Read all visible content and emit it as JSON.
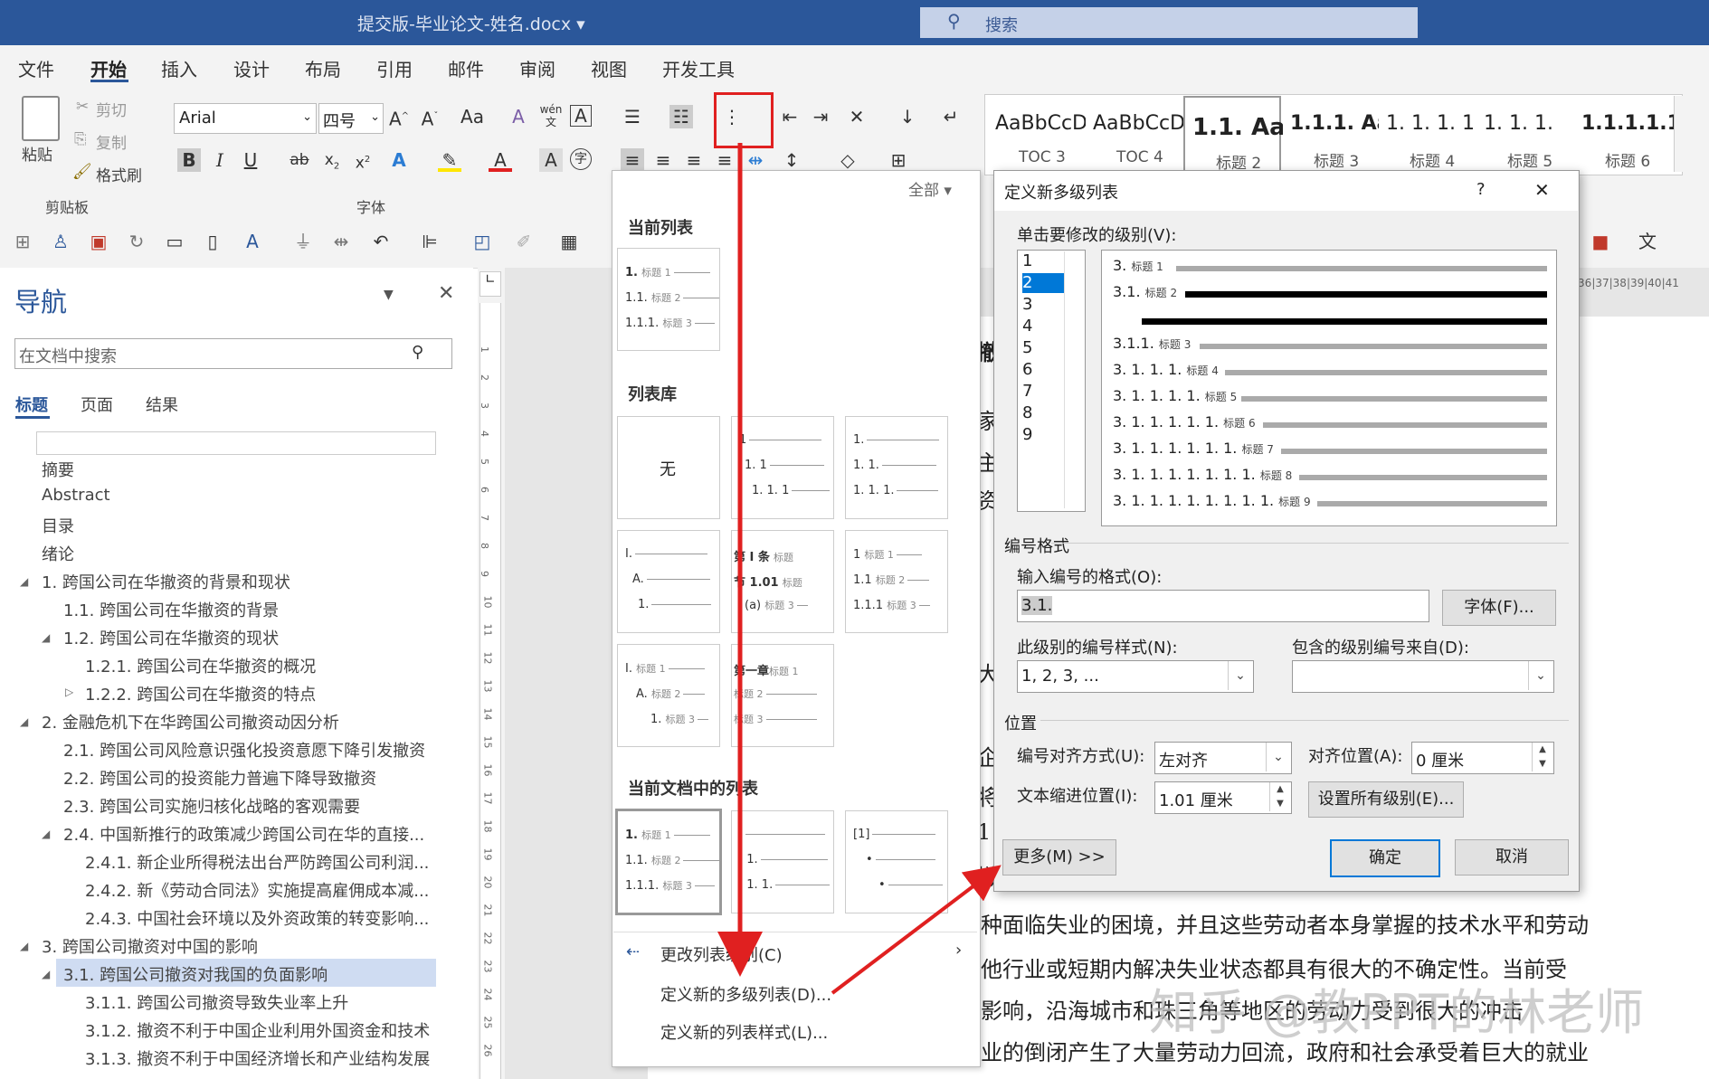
{
  "title_bar": {
    "doc_title": "提交版-毕业论文-姓名.docx ▾",
    "search_placeholder": "搜索"
  },
  "menu": [
    "文件",
    "开始",
    "插入",
    "设计",
    "布局",
    "引用",
    "邮件",
    "审阅",
    "视图",
    "开发工具"
  ],
  "ribbon": {
    "clipboard": {
      "paste": "粘贴",
      "cut": "剪切",
      "copy": "复制",
      "format_painter": "格式刷",
      "group": "剪贴板"
    },
    "font": {
      "family": "Arial",
      "size": "四号",
      "group": "字体",
      "wen": "wén"
    },
    "styles": [
      {
        "sample": "AaBbCcDc",
        "name": "TOC 3"
      },
      {
        "sample": "AaBbCcDc",
        "name": "TOC 4"
      },
      {
        "sample": "1.1.  Aa",
        "name": "标题 2"
      },
      {
        "sample": "1.1.1.  Aa",
        "name": "标题 3"
      },
      {
        "sample": "1. 1. 1. 1",
        "name": "标题 4"
      },
      {
        "sample": "1. 1. 1.",
        "name": "标题 5"
      },
      {
        "sample": "1.1.1.1.1",
        "name": "标题 6"
      }
    ]
  },
  "nav": {
    "title": "导航",
    "search_placeholder": "在文档中搜索",
    "tabs": [
      "标题",
      "页面",
      "结果"
    ],
    "items": [
      "摘要",
      "Abstract",
      "目录",
      "绪论",
      "1. 跨国公司在华撤资的背景和现状",
      "1.1. 跨国公司在华撤资的背景",
      "1.2. 跨国公司在华撤资的现状",
      "1.2.1. 跨国公司在华撤资的概况",
      "1.2.2. 跨国公司在华撤资的特点",
      "2. 金融危机下在华跨国公司撤资动因分析",
      "2.1. 跨国公司风险意识强化投资意愿下降引发撤资",
      "2.2. 跨国公司的投资能力普遍下降导致撤资",
      "2.3. 跨国公司实施归核化战略的客观需要",
      "2.4. 中国新推行的政策减少跨国公司在华的直接...",
      "2.4.1. 新企业所得税法出台严防跨国公司利润...",
      "2.4.2. 新《劳动合同法》实施提高雇佣成本减...",
      "2.4.3. 中国社会环境以及外资政策的转变影响...",
      "3. 跨国公司撤资对中国的影响",
      "3.1. 跨国公司撤资对我国的负面影响",
      "3.1.1. 跨国公司撤资导致失业率上升",
      "3.1.2. 撤资不利于中国企业利用外国资金和技术",
      "3.1.3. 撤资不利于中国经济增长和产业结构发展"
    ]
  },
  "ruler": {
    "vertical": [
      "1",
      "2",
      "3",
      "4",
      "5",
      "6",
      "7",
      "8",
      "9",
      "10",
      "11",
      "12",
      "13",
      "14",
      "15",
      "16",
      "17",
      "18",
      "19",
      "20",
      "21",
      "22",
      "23",
      "24",
      "25",
      "26"
    ],
    "horizontal": "|36|37|38|39|40|41"
  },
  "doc_body": {
    "lines": [
      "种面临失业的困境，并且这些劳动者本身掌握的技术水平和劳动",
      "他行业或短期内解决失业状态都具有很大的不确定性。当前受",
      "影响，沿海城市和珠三角等地区的劳动力受到很大的冲击",
      "业的倒闭产生了大量劳动力回流，政府和社会承受着巨大的就业"
    ],
    "margin_chars": [
      "撤",
      "家",
      "主",
      "资",
      "大",
      "企",
      "将",
      "1",
      "撤"
    ],
    "watermark": "知乎 @教PPT的林老师"
  },
  "dropdown": {
    "filter": "全部 ▾",
    "current_list": "当前列表",
    "library": "列表库",
    "none": "无",
    "in_doc": "当前文档中的列表",
    "change_level": "更改列表级别(C)",
    "define_multilevel": "定义新的多级列表(D)...",
    "define_style": "定义新的列表样式(L)..."
  },
  "dialog": {
    "title": "定义新多级列表",
    "help": "?",
    "close": "✕",
    "level_label": "单击要修改的级别(V):",
    "levels": [
      "1",
      "2",
      "3",
      "4",
      "5",
      "6",
      "7",
      "8",
      "9"
    ],
    "selected_level": "2",
    "preview": [
      {
        "num": "3.",
        "h": "标题 1"
      },
      {
        "num": "3.1.",
        "h": "标题 2"
      },
      {
        "num": "3.1.1.",
        "h": "标题 3"
      },
      {
        "num": "3. 1. 1. 1.",
        "h": "标题 4"
      },
      {
        "num": "3. 1. 1. 1. 1.",
        "h": "标题 5"
      },
      {
        "num": "3. 1. 1. 1. 1. 1.",
        "h": "标题 6"
      },
      {
        "num": "3. 1. 1. 1. 1. 1. 1.",
        "h": "标题 7"
      },
      {
        "num": "3. 1. 1. 1. 1. 1. 1. 1.",
        "h": "标题 8"
      },
      {
        "num": "3. 1. 1. 1. 1. 1. 1. 1. 1.",
        "h": "标题 9"
      }
    ],
    "number_format_group": "编号格式",
    "enter_format_label": "输入编号的格式(O):",
    "format_value": "3.1.",
    "font_button": "字体(F)...",
    "style_label": "此级别的编号样式(N):",
    "style_value": "1, 2, 3, ...",
    "include_label": "包含的级别编号来自(D):",
    "include_value": "",
    "position_group": "位置",
    "align_label": "编号对齐方式(U):",
    "align_value": "左对齐",
    "align_at_label": "对齐位置(A):",
    "align_at_value": "0 厘米",
    "indent_label": "文本缩进位置(I):",
    "indent_value": "1.01 厘米",
    "set_all_button": "设置所有级别(E)...",
    "more_button": "更多(M) >>",
    "ok_button": "确定",
    "cancel_button": "取消"
  },
  "colors": {
    "accent": "#2b579a",
    "annotation": "#e02020",
    "selection": "#0078d7"
  }
}
